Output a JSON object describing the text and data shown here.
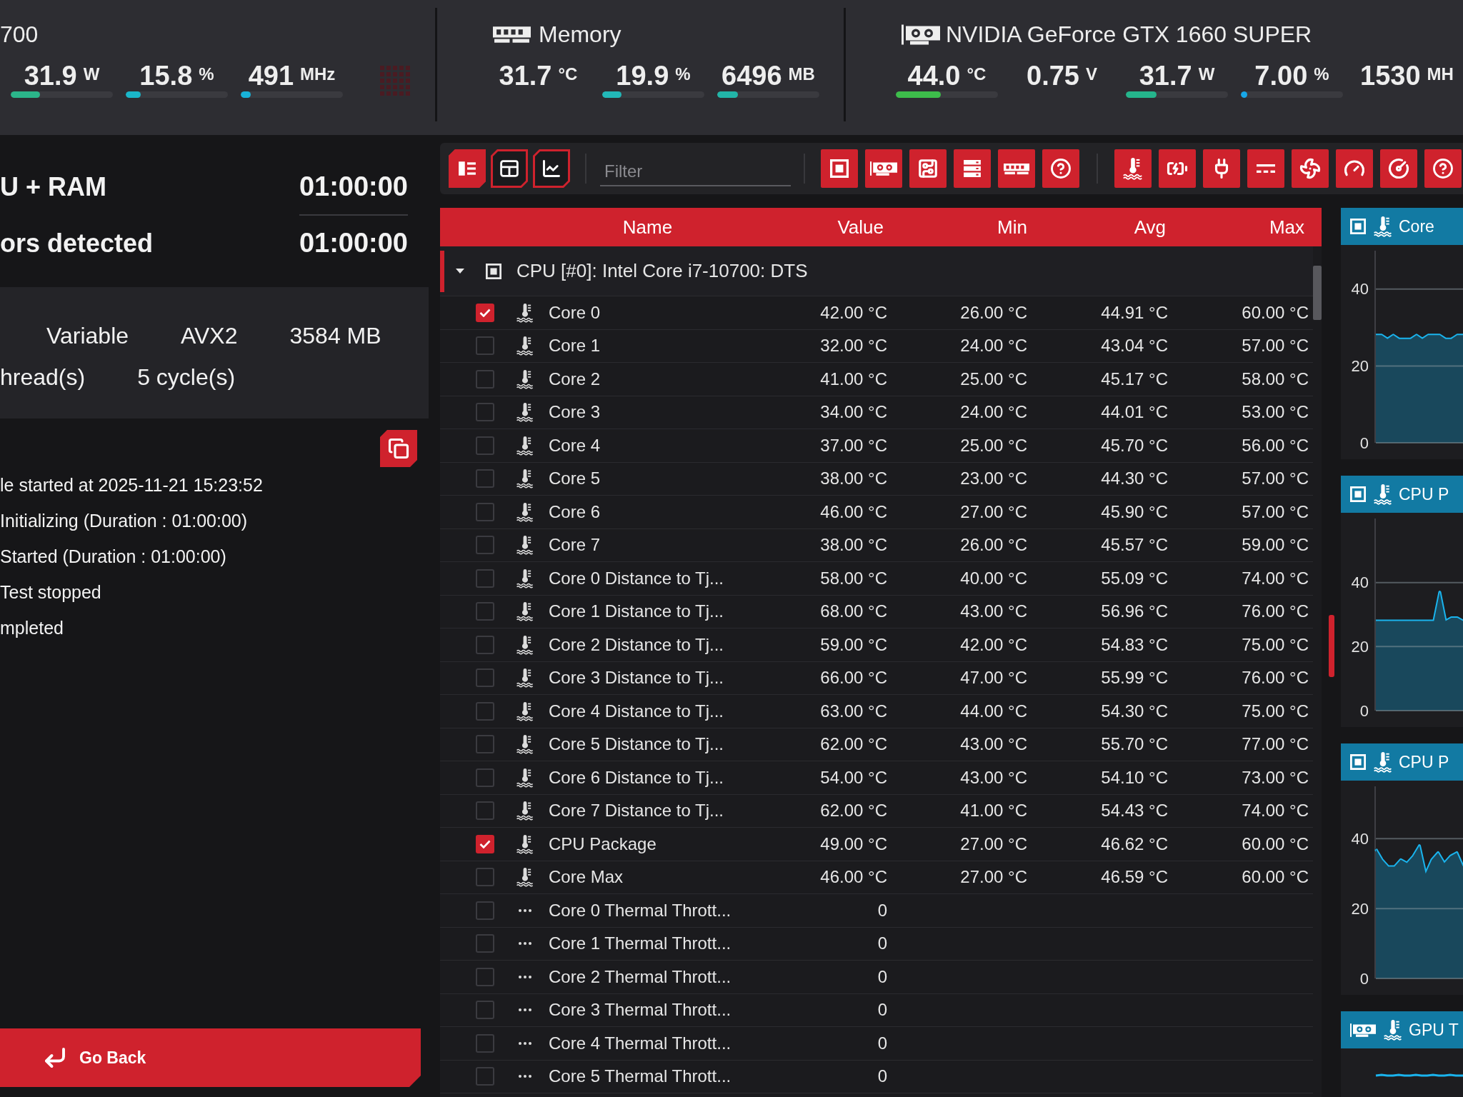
{
  "hardware_bar": [
    {
      "title": "700",
      "load_grid": true,
      "metrics": [
        {
          "value": "31.9",
          "unit": "W",
          "level": 0.29,
          "color": "#2bb58a"
        },
        {
          "value": "15.8",
          "unit": "%",
          "level": 0.15,
          "color": "#1ab6c9"
        },
        {
          "value": "491",
          "unit": "MHz",
          "level": 0.1,
          "color": "#18b2d8"
        }
      ]
    },
    {
      "kind": "memory",
      "title": "Memory",
      "metrics": [
        {
          "value": "31.7",
          "unit": "°C"
        },
        {
          "value": "19.9",
          "unit": "%",
          "level": 0.19,
          "color": "#22b8b8"
        },
        {
          "value": "6496",
          "unit": "MB",
          "level": 0.2,
          "color": "#22b5a8"
        }
      ]
    },
    {
      "kind": "gpu",
      "title": "NVIDIA GeForce GTX 1660 SUPER",
      "metrics": [
        {
          "value": "44.0",
          "unit": "°C",
          "level": 0.44,
          "color": "#3dbd4b"
        },
        {
          "value": "0.75",
          "unit": "V"
        },
        {
          "value": "31.7",
          "unit": "W",
          "level": 0.3,
          "color": "#25b58c"
        },
        {
          "value": "7.00",
          "unit": "%",
          "level": 0.05,
          "color": "#17a7e8"
        },
        {
          "value": "1530",
          "unit": "MH"
        }
      ]
    }
  ],
  "test": {
    "summary": [
      {
        "label": "U + RAM",
        "time": "01:00:00"
      },
      {
        "label": "ors detected",
        "time": "01:00:00"
      }
    ],
    "settings": [
      [
        "Variable",
        "AVX2",
        "3584 MB"
      ],
      [
        "hread(s)",
        "5 cycle(s)"
      ]
    ],
    "log": [
      "le started at 2025-11-21 15:23:52",
      "Initializing (Duration : 01:00:00)",
      "Started (Duration : 01:00:00)",
      "Test stopped",
      "mpleted"
    ]
  },
  "go_back": {
    "label": "Go Back"
  },
  "toolbar": {
    "view_buttons": [
      {
        "kind": "details",
        "selected": true
      },
      {
        "kind": "table",
        "selected": false
      },
      {
        "kind": "chart",
        "selected": false
      }
    ],
    "filter": {
      "placeholder": "Filter"
    },
    "hardware_filters": [
      {
        "kind": "cpu",
        "on": true
      },
      {
        "kind": "gpu",
        "on": true
      },
      {
        "kind": "motherboard",
        "on": true
      },
      {
        "kind": "storage",
        "on": true
      },
      {
        "kind": "memory",
        "on": true
      },
      {
        "kind": "other",
        "on": true
      }
    ],
    "sensor_filters": [
      {
        "kind": "temperature",
        "on": true
      },
      {
        "kind": "voltage",
        "on": true
      },
      {
        "kind": "power",
        "on": true
      },
      {
        "kind": "current",
        "on": true
      },
      {
        "kind": "fan",
        "on": true
      },
      {
        "kind": "clock",
        "on": true
      },
      {
        "kind": "usage",
        "on": true
      },
      {
        "kind": "other",
        "on": true
      }
    ]
  },
  "sensor_table": {
    "columns": [
      "Name",
      "Value",
      "Min",
      "Avg",
      "Max"
    ],
    "groups": [
      {
        "kind": "cpu",
        "title": "CPU [#0]: Intel Core i7-10700: DTS",
        "expanded": true,
        "rows": [
          {
            "kind": "temperature",
            "checked": true,
            "name": "Core 0",
            "value": "42.00 °C",
            "min": "26.00 °C",
            "avg": "44.91 °C",
            "max": "60.00 °C"
          },
          {
            "kind": "temperature",
            "checked": false,
            "name": "Core 1",
            "value": "32.00 °C",
            "min": "24.00 °C",
            "avg": "43.04 °C",
            "max": "57.00 °C"
          },
          {
            "kind": "temperature",
            "checked": false,
            "name": "Core 2",
            "value": "41.00 °C",
            "min": "25.00 °C",
            "avg": "45.17 °C",
            "max": "58.00 °C"
          },
          {
            "kind": "temperature",
            "checked": false,
            "name": "Core 3",
            "value": "34.00 °C",
            "min": "24.00 °C",
            "avg": "44.01 °C",
            "max": "53.00 °C"
          },
          {
            "kind": "temperature",
            "checked": false,
            "name": "Core 4",
            "value": "37.00 °C",
            "min": "25.00 °C",
            "avg": "45.70 °C",
            "max": "56.00 °C"
          },
          {
            "kind": "temperature",
            "checked": false,
            "name": "Core 5",
            "value": "38.00 °C",
            "min": "23.00 °C",
            "avg": "44.30 °C",
            "max": "57.00 °C"
          },
          {
            "kind": "temperature",
            "checked": false,
            "name": "Core 6",
            "value": "46.00 °C",
            "min": "27.00 °C",
            "avg": "45.90 °C",
            "max": "57.00 °C"
          },
          {
            "kind": "temperature",
            "checked": false,
            "name": "Core 7",
            "value": "38.00 °C",
            "min": "26.00 °C",
            "avg": "45.57 °C",
            "max": "59.00 °C"
          },
          {
            "kind": "temperature",
            "checked": false,
            "name": "Core 0 Distance to Tj...",
            "value": "58.00 °C",
            "min": "40.00 °C",
            "avg": "55.09 °C",
            "max": "74.00 °C"
          },
          {
            "kind": "temperature",
            "checked": false,
            "name": "Core 1 Distance to Tj...",
            "value": "68.00 °C",
            "min": "43.00 °C",
            "avg": "56.96 °C",
            "max": "76.00 °C"
          },
          {
            "kind": "temperature",
            "checked": false,
            "name": "Core 2 Distance to Tj...",
            "value": "59.00 °C",
            "min": "42.00 °C",
            "avg": "54.83 °C",
            "max": "75.00 °C"
          },
          {
            "kind": "temperature",
            "checked": false,
            "name": "Core 3 Distance to Tj...",
            "value": "66.00 °C",
            "min": "47.00 °C",
            "avg": "55.99 °C",
            "max": "76.00 °C"
          },
          {
            "kind": "temperature",
            "checked": false,
            "name": "Core 4 Distance to Tj...",
            "value": "63.00 °C",
            "min": "44.00 °C",
            "avg": "54.30 °C",
            "max": "75.00 °C"
          },
          {
            "kind": "temperature",
            "checked": false,
            "name": "Core 5 Distance to Tj...",
            "value": "62.00 °C",
            "min": "43.00 °C",
            "avg": "55.70 °C",
            "max": "77.00 °C"
          },
          {
            "kind": "temperature",
            "checked": false,
            "name": "Core 6 Distance to Tj...",
            "value": "54.00 °C",
            "min": "43.00 °C",
            "avg": "54.10 °C",
            "max": "73.00 °C"
          },
          {
            "kind": "temperature",
            "checked": false,
            "name": "Core 7 Distance to Tj...",
            "value": "62.00 °C",
            "min": "41.00 °C",
            "avg": "54.43 °C",
            "max": "74.00 °C"
          },
          {
            "kind": "temperature",
            "checked": true,
            "name": "CPU Package",
            "value": "49.00 °C",
            "min": "27.00 °C",
            "avg": "46.62 °C",
            "max": "60.00 °C"
          },
          {
            "kind": "temperature",
            "checked": false,
            "name": "Core Max",
            "value": "46.00 °C",
            "min": "27.00 °C",
            "avg": "46.59 °C",
            "max": "60.00 °C"
          },
          {
            "kind": "other",
            "checked": false,
            "name": "Core 0 Thermal Thrott...",
            "value": "0"
          },
          {
            "kind": "other",
            "checked": false,
            "name": "Core 1 Thermal Thrott...",
            "value": "0"
          },
          {
            "kind": "other",
            "checked": false,
            "name": "Core 2 Thermal Thrott...",
            "value": "0"
          },
          {
            "kind": "other",
            "checked": false,
            "name": "Core 3 Thermal Thrott...",
            "value": "0"
          },
          {
            "kind": "other",
            "checked": false,
            "name": "Core 4 Thermal Thrott...",
            "value": "0"
          },
          {
            "kind": "other",
            "checked": false,
            "name": "Core 5 Thermal Thrott...",
            "value": "0"
          }
        ]
      }
    ]
  },
  "charts": [
    {
      "kind": "cpu",
      "title": "Core",
      "chart_data": {
        "type": "area",
        "ylim": [
          0,
          50
        ],
        "yticks": [
          0,
          20,
          40
        ],
        "values": [
          28,
          28,
          27,
          28,
          27,
          27,
          27,
          28,
          27,
          28,
          28,
          28,
          27,
          27,
          28,
          28
        ]
      }
    },
    {
      "kind": "cpu",
      "title": "CPU P",
      "chart_data": {
        "type": "area",
        "ylim": [
          0,
          60
        ],
        "yticks": [
          0,
          20,
          40
        ],
        "values": [
          28,
          28,
          28,
          28,
          28,
          28,
          28,
          28,
          28,
          28,
          28,
          37,
          28,
          29,
          29,
          28
        ]
      }
    },
    {
      "kind": "cpu",
      "title": "CPU P",
      "chart_data": {
        "type": "area",
        "ylim": [
          0,
          55
        ],
        "yticks": [
          0,
          20,
          40
        ],
        "values": [
          37,
          34,
          32,
          32,
          34,
          33,
          35,
          38,
          30,
          34,
          36,
          33,
          35,
          36,
          32
        ]
      }
    },
    {
      "kind": "gpu",
      "title": "GPU T"
    }
  ]
}
